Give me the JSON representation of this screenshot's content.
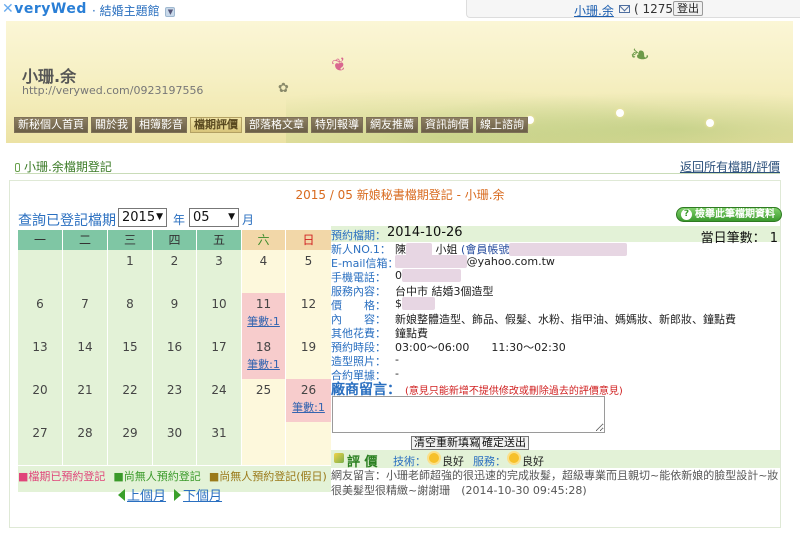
{
  "top": {
    "logo": "veryWed",
    "site_title": "結婚主題館",
    "user": "小珊.余",
    "mail_count": "( 1275 )",
    "logout": "登出"
  },
  "banner": {
    "name": "小珊.余",
    "url": "http://verywed.com/0923197556"
  },
  "nav": [
    "新秘個人首頁",
    "關於我",
    "相簿影音",
    "檔期評價",
    "部落格文章",
    "特別報導",
    "網友推薦",
    "資訊詢價",
    "線上諮詢"
  ],
  "section": {
    "title": "小珊.余檔期登記",
    "back_link": "返回所有檔期/評價"
  },
  "calendar": {
    "caption": "2015 / 05 新娘秘書檔期登記 - 小珊.余",
    "query_label": "查詢已登記檔期",
    "year": "2015",
    "year_unit": "年",
    "month": "05",
    "month_unit": "月",
    "weekdays": [
      "一",
      "二",
      "三",
      "四",
      "五",
      "六",
      "日"
    ],
    "weeks": [
      [
        {
          "d": ""
        },
        {
          "d": ""
        },
        {
          "d": "1"
        },
        {
          "d": "2"
        },
        {
          "d": "3"
        },
        {
          "d": "4"
        },
        {
          "d": "5"
        }
      ],
      [
        {
          "d": "6"
        },
        {
          "d": "7"
        },
        {
          "d": "8"
        },
        {
          "d": "9"
        },
        {
          "d": "10"
        },
        {
          "d": "11",
          "c": "筆數:1"
        },
        {
          "d": "12"
        }
      ],
      [
        {
          "d": "13"
        },
        {
          "d": "14"
        },
        {
          "d": "15"
        },
        {
          "d": "16"
        },
        {
          "d": "17"
        },
        {
          "d": "18",
          "c": "筆數:1"
        },
        {
          "d": "19"
        }
      ],
      [
        {
          "d": "20"
        },
        {
          "d": "21"
        },
        {
          "d": "22"
        },
        {
          "d": "23"
        },
        {
          "d": "24"
        },
        {
          "d": "25"
        },
        {
          "d": "26",
          "c": "筆數:1"
        }
      ],
      [
        {
          "d": "27"
        },
        {
          "d": "28"
        },
        {
          "d": "29"
        },
        {
          "d": "30"
        },
        {
          "d": "31"
        },
        {
          "d": ""
        },
        {
          "d": ""
        }
      ]
    ],
    "legend": [
      "■檔期已預約登記",
      "■尚無人預約登記",
      "■尚無人預約登記(假日)"
    ],
    "prev": "上個月",
    "next": "下個月"
  },
  "detail": {
    "date_label": "預約檔期：",
    "date_value": "2014-10-26",
    "count_label": "當日筆數：",
    "count_value": "1",
    "report_button": "檢舉此筆檔期資料",
    "fields": [
      {
        "k": "新人NO.1：",
        "v": "陳",
        "extra": "小姐",
        "acct": "(會員帳號"
      },
      {
        "k": "E-mail信箱：",
        "v": "@yahoo.com.tw"
      },
      {
        "k": "手機電話：",
        "v": "0"
      },
      {
        "k": "服務內容：",
        "v": "台中市 結婚3個造型"
      },
      {
        "k": "價　　格：",
        "v": "$"
      },
      {
        "k": "內　　容：",
        "v": "新娘整體造型、飾品、假髮、水粉、指甲油、媽媽妝、新郎妝、鐘點費"
      },
      {
        "k": "其他花費：",
        "v": "鐘點費"
      },
      {
        "k": "預約時段：",
        "v": "03:00～06:00　　11:30～02:30"
      },
      {
        "k": "造型照片：",
        "v": "-"
      },
      {
        "k": "合約單據：",
        "v": "-"
      }
    ],
    "message_title": "廠商留言：",
    "message_note": "(意見只能新增不提供修改或刪除過去的評價意見)",
    "reset_button": "清空重新填寫",
    "submit_button": "確定送出",
    "rating_title": "評 價",
    "tech_label": "技術：",
    "tech_value": "良好",
    "service_label": "服務：",
    "service_value": "良好",
    "comment": "網友留言：小珊老師超強的很迅速的完成妝髮，超級專業而且親切~能依新娘的臉型設計~妝很美髮型很精緻~謝謝珊",
    "comment_time": "(2014-10-30 09:45:28)"
  }
}
